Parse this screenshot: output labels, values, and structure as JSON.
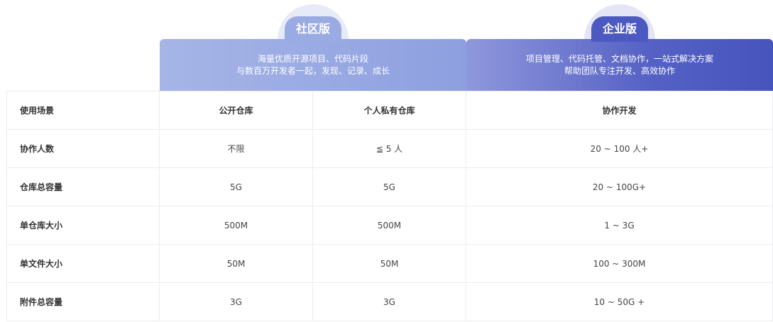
{
  "plans": {
    "community": {
      "name": "社区版",
      "desc_line1": "海量优质开源项目、代码片段",
      "desc_line2": "与数百万开发者一起，发现、记录、成长"
    },
    "enterprise": {
      "name": "企业版",
      "desc_line1": "项目管理、代码托管、文档协作，一站式解决方案",
      "desc_line2": "帮助团队专注开发、高效协作"
    }
  },
  "rows": [
    {
      "label": "使用场景",
      "c1": "公开仓库",
      "c2": "个人私有仓库",
      "c3": "协作开发"
    },
    {
      "label": "协作人数",
      "c1": "不限",
      "c2": "≦ 5 人",
      "c3": "20 ~ 100 人+"
    },
    {
      "label": "仓库总容量",
      "c1": "5G",
      "c2": "5G",
      "c3": "20 ~ 100G+"
    },
    {
      "label": "单仓库大小",
      "c1": "500M",
      "c2": "500M",
      "c3": "1 ~ 3G"
    },
    {
      "label": "单文件大小",
      "c1": "50M",
      "c2": "50M",
      "c3": "100 ~ 300M"
    },
    {
      "label": "附件总容量",
      "c1": "3G",
      "c2": "3G",
      "c3": "10 ~ 50G +"
    }
  ],
  "colors": {
    "community_accent": "#9aaae2",
    "enterprise_accent": "#4c59c1"
  }
}
